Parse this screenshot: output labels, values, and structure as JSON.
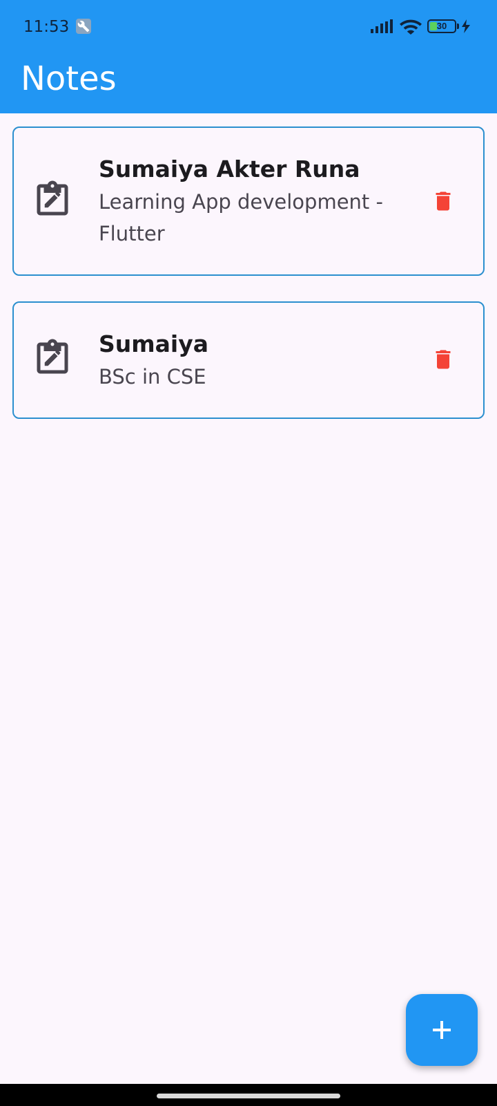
{
  "status_bar": {
    "time": "11:53",
    "battery_level": "30",
    "battery_fraction": 0.3
  },
  "app_bar": {
    "title": "Notes",
    "color": "#2196f3"
  },
  "notes": [
    {
      "title": "Sumaiya Akter Runa",
      "body": "Learning App development - Flutter",
      "icon": "edit-note-icon",
      "action_icon": "delete-icon"
    },
    {
      "title": "Sumaiya",
      "body": "BSc in CSE",
      "icon": "edit-note-icon",
      "action_icon": "delete-icon"
    }
  ],
  "fab": {
    "icon": "add-icon",
    "color": "#2196f3"
  },
  "colors": {
    "delete": "#f44336",
    "card_border": "#2b8fcf",
    "background": "#fcf6fd"
  }
}
